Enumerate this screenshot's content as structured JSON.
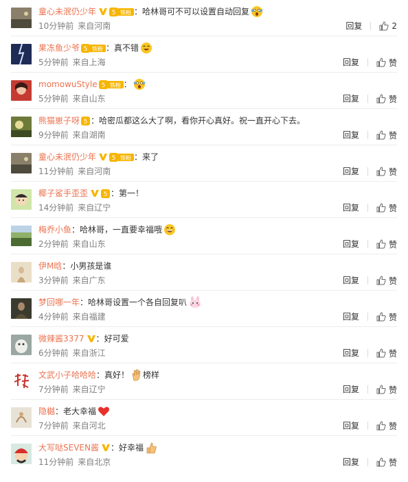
{
  "colors": {
    "username": "#eb7350",
    "meta": "#808080",
    "text": "#333333",
    "vip": "#f7b500"
  },
  "labels": {
    "reply": "回复",
    "like": "赞",
    "fan_badge": "铁粉"
  },
  "comments": [
    {
      "user": "童心未泯仍少年",
      "verified": true,
      "fan": true,
      "text": "哈林哥可不可以设置自动回复",
      "emoji": "shock-emoji",
      "time": "10分钟前",
      "loc": "来自河南",
      "likes": "2"
    },
    {
      "user": "果冻鱼少爷",
      "verified": false,
      "fan": true,
      "text": "真不错",
      "emoji": "grin-emoji",
      "time": "5分钟前",
      "loc": "来自上海",
      "likes": "赞"
    },
    {
      "user": "momowuStyle",
      "verified": false,
      "fan": true,
      "text": "",
      "emoji": "shock-emoji",
      "time": "5分钟前",
      "loc": "来自山东",
      "likes": "赞"
    },
    {
      "user": "熊猫崽子呀",
      "verified": false,
      "fan": false,
      "text": "哈密瓜都这么大了啊，看你开心真好。祝一直开心下去。",
      "emoji": "",
      "time": "9分钟前",
      "loc": "来自湖南",
      "likes": "赞"
    },
    {
      "user": "童心未泯仍少年",
      "verified": true,
      "fan": true,
      "text": "来了",
      "emoji": "",
      "time": "11分钟前",
      "loc": "来自河南",
      "likes": "赞"
    },
    {
      "user": "椰子鲨手歪歪",
      "verified": true,
      "fan": false,
      "text": "第一！",
      "emoji": "",
      "time": "14分钟前",
      "loc": "来自辽宁",
      "likes": "赞"
    },
    {
      "user": "梅乔小鱼",
      "verified": false,
      "fan": false,
      "text": "哈林哥，一直要幸福哦",
      "emoji": "laugh-emoji",
      "time": "2分钟前",
      "loc": "来自山东",
      "likes": "赞"
    },
    {
      "user": "伊M晗",
      "verified": false,
      "fan": false,
      "text": "小男孩是谁",
      "emoji": "",
      "time": "3分钟前",
      "loc": "来自广东",
      "likes": "赞"
    },
    {
      "user": "梦回哪一年",
      "verified": false,
      "fan": false,
      "text": "哈林哥设置一个各自回复叭",
      "emoji": "bunny-emoji",
      "time": "4分钟前",
      "loc": "来自福建",
      "likes": "赞"
    },
    {
      "user": "微辣酱3377",
      "verified": true,
      "fan": false,
      "text": "好可爱",
      "emoji": "",
      "time": "6分钟前",
      "loc": "来自浙江",
      "likes": "赞"
    },
    {
      "user": "文武小子哈哈哈",
      "verified": false,
      "fan": false,
      "text": "真好！",
      "emoji": "clap-emoji",
      "text2": "榜样",
      "time": "7分钟前",
      "loc": "来自辽宁",
      "likes": "赞"
    },
    {
      "user": "隐樾",
      "verified": false,
      "fan": false,
      "text": "老大幸福",
      "emoji": "heart-emoji",
      "time": "7分钟前",
      "loc": "来自河北",
      "likes": "赞"
    },
    {
      "user": "大写哒SEVEN酱",
      "verified": true,
      "fan": false,
      "text": "好幸福",
      "emoji": "thumb-emoji",
      "time": "11分钟前",
      "loc": "来自北京",
      "likes": "赞"
    }
  ]
}
